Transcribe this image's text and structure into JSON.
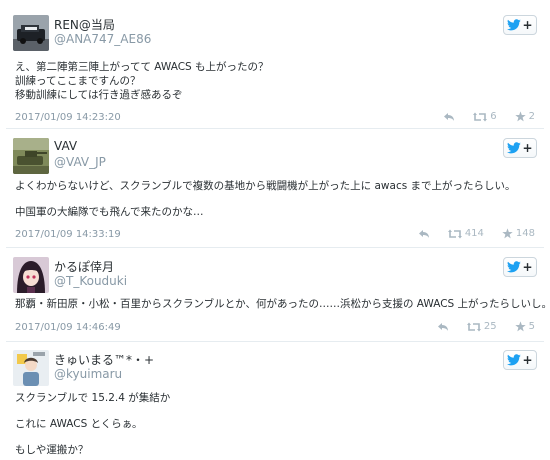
{
  "tweets": [
    {
      "display_name": "REN@当局",
      "handle": "@ANA747_AE86",
      "lines": [
        "え、第二陣第三陣上がってて AWACS も上がったの？",
        "訓練ってここまですんの？",
        "移動訓練にしては行き過ぎ感あるぞ"
      ],
      "timestamp": "2017/01/09 14:23:20",
      "retweets": "6",
      "likes": "2",
      "avatar_icon": "car-photo-avatar"
    },
    {
      "display_name": "VAV",
      "handle": "@VAV_JP",
      "lines": [
        "よくわからないけど、スクランブルで複数の基地から戦闘機が上がった上に awacs まで上がったらしい。",
        "",
        "中国軍の大編隊でも飛んで来たのかな…"
      ],
      "timestamp": "2017/01/09 14:33:19",
      "retweets": "414",
      "likes": "148",
      "avatar_icon": "tank-photo-avatar"
    },
    {
      "display_name": "かるぽ倖月",
      "handle": "@T_Kouduki",
      "lines": [
        "那覇・新田原・小松・百里からスクランブルとか、何があったの……浜松から支援の AWACS 上がったらしいし。"
      ],
      "timestamp": "2017/01/09 14:46:49",
      "retweets": "25",
      "likes": "5",
      "avatar_icon": "anime-girl-avatar"
    },
    {
      "display_name": "きゅいまる™*・+",
      "handle": "@kyuimaru",
      "lines": [
        "スクランブルで 15.2.4 が集結か",
        "",
        "これに AWACS とくらぁ。",
        "",
        "もしや運搬か？"
      ],
      "timestamp": "",
      "retweets": "",
      "likes": "",
      "avatar_icon": "character-avatar"
    }
  ],
  "colors": {
    "text": "#292f33",
    "meta": "#8899a6",
    "action": "#aab8c2",
    "twitter_blue": "#1da1f2",
    "separator": "#e6ecf0"
  }
}
